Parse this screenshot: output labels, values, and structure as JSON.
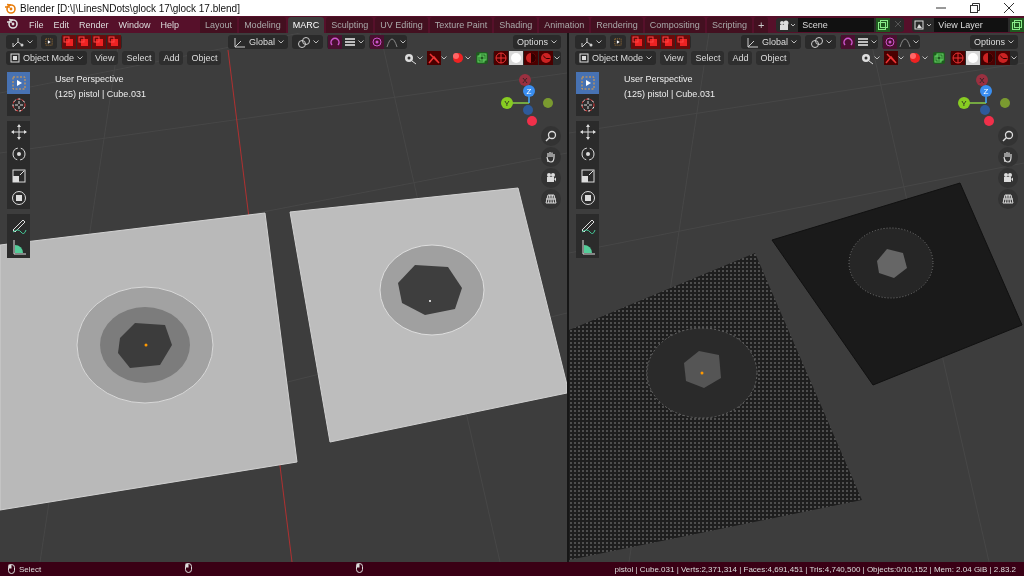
{
  "window": {
    "title": "Blender [D:\\|\\LinesNDots\\glock 17\\glock 17.blend]"
  },
  "menu": [
    "File",
    "Edit",
    "Render",
    "Window",
    "Help"
  ],
  "workspaces": [
    {
      "label": "Layout",
      "selected": false
    },
    {
      "label": "Modeling",
      "selected": false
    },
    {
      "label": "MARC",
      "selected": true
    },
    {
      "label": "Sculpting",
      "selected": false
    },
    {
      "label": "UV Editing",
      "selected": false
    },
    {
      "label": "Texture Paint",
      "selected": false
    },
    {
      "label": "Shading",
      "selected": false
    },
    {
      "label": "Animation",
      "selected": false
    },
    {
      "label": "Rendering",
      "selected": false
    },
    {
      "label": "Compositing",
      "selected": false
    },
    {
      "label": "Scripting",
      "selected": false
    }
  ],
  "add_workspace": "+",
  "scene": {
    "value": "Scene"
  },
  "view_layer": {
    "value": "View Layer"
  },
  "viewports": [
    {
      "kind": "solid",
      "orientation": "Global",
      "options": "Options",
      "mode": "Object Mode",
      "menus": [
        "View",
        "Select",
        "Add",
        "Object"
      ],
      "overlay": [
        "User Perspective",
        "(125) pistol | Cube.031"
      ],
      "axes": [
        "X",
        "Y",
        "Z"
      ],
      "shading": [
        {
          "selected": false
        },
        {
          "selected": true
        },
        {
          "selected": false
        },
        {
          "selected": false
        }
      ],
      "tools": [
        {
          "kind": "select",
          "selected": true
        },
        {
          "kind": "cursor",
          "selected": false
        },
        {
          "kind": "move",
          "selected": false
        },
        {
          "kind": "rotate",
          "selected": false
        },
        {
          "kind": "scale",
          "selected": false
        },
        {
          "kind": "transform",
          "selected": false
        },
        {
          "kind": "annotate",
          "selected": false
        },
        {
          "kind": "measure",
          "selected": false
        }
      ]
    },
    {
      "kind": "points",
      "orientation": "Global",
      "options": "Options",
      "mode": "Object Mode",
      "menus": [
        "View",
        "Select",
        "Add",
        "Object"
      ],
      "overlay": [
        "User Perspective",
        "(125) pistol | Cube.031"
      ],
      "axes": [
        "X",
        "Y",
        "Z"
      ],
      "shading": [
        {
          "selected": false
        },
        {
          "selected": true
        },
        {
          "selected": false
        },
        {
          "selected": false
        }
      ],
      "tools": [
        {
          "kind": "select",
          "selected": true
        },
        {
          "kind": "cursor",
          "selected": false
        },
        {
          "kind": "move",
          "selected": false
        },
        {
          "kind": "rotate",
          "selected": false
        },
        {
          "kind": "scale",
          "selected": false
        },
        {
          "kind": "transform",
          "selected": false
        },
        {
          "kind": "annotate",
          "selected": false
        },
        {
          "kind": "measure",
          "selected": false
        }
      ]
    }
  ],
  "status_bar": {
    "hint": "Select",
    "stats": "pistol | Cube.031 | Verts:2,371,314 | Faces:4,691,451 | Tris:4,740,500 | Objects:0/10,152 | Mem: 2.04 GiB | 2.83.2"
  }
}
